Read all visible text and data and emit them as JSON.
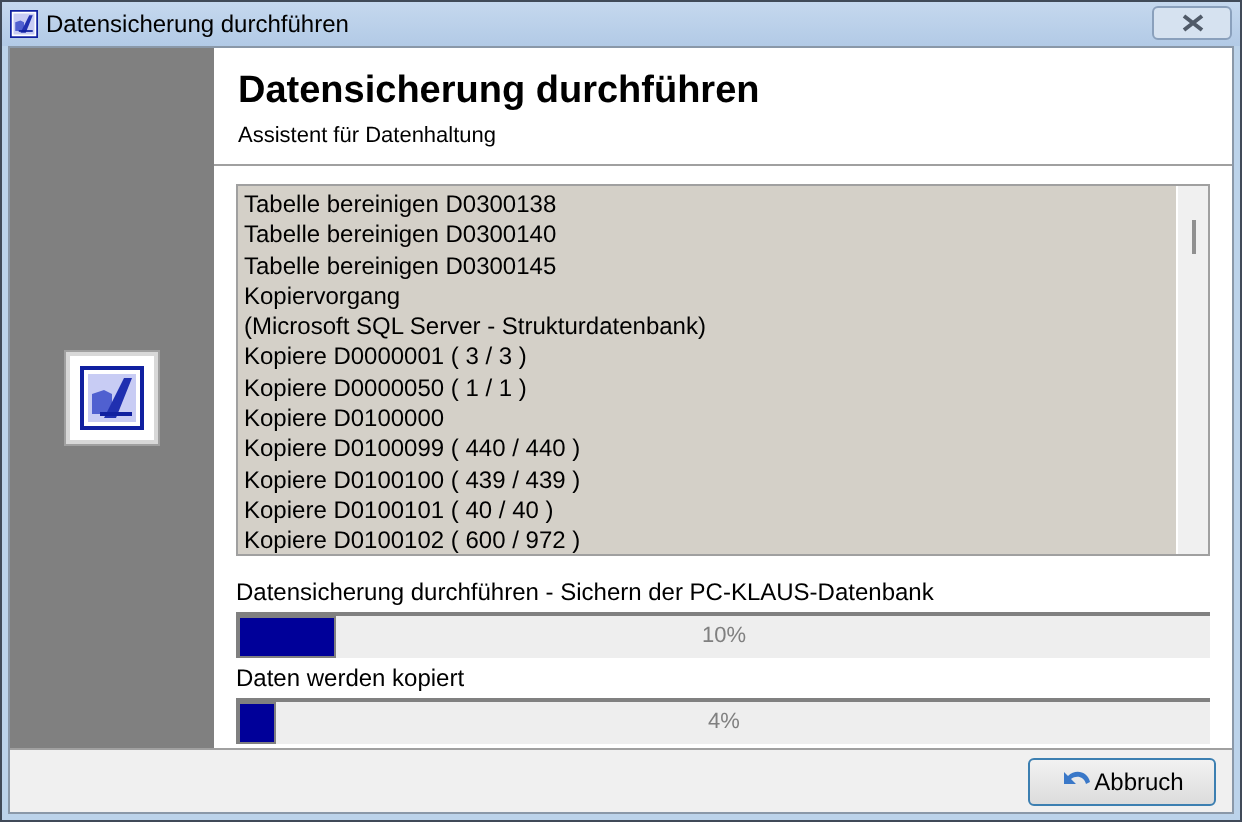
{
  "window": {
    "title": "Datensicherung durchführen"
  },
  "header": {
    "title": "Datensicherung durchführen",
    "subtitle": "Assistent für Datenhaltung"
  },
  "log": [
    "Tabelle bereinigen D0300138",
    "Tabelle bereinigen D0300140",
    "Tabelle bereinigen D0300145",
    "Kopiervorgang",
    "(Microsoft SQL Server - Strukturdatenbank)",
    "Kopiere D0000001 ( 3 / 3 )",
    "Kopiere D0000050 ( 1 / 1 )",
    "Kopiere D0100000",
    "Kopiere D0100099 ( 440 / 440 )",
    "Kopiere D0100100 ( 439 / 439 )",
    "Kopiere D0100101 ( 40 / 40 )",
    "Kopiere D0100102 ( 600 / 972 )"
  ],
  "progress": [
    {
      "label": "Datensicherung durchführen - Sichern der PC-KLAUS-Datenbank",
      "level": 0.1,
      "reading": "10%"
    },
    {
      "label": "Daten werden kopiert",
      "level": 0.04,
      "reading": "4%"
    }
  ],
  "buttons": [
    {
      "label": "Abbruch"
    }
  ]
}
